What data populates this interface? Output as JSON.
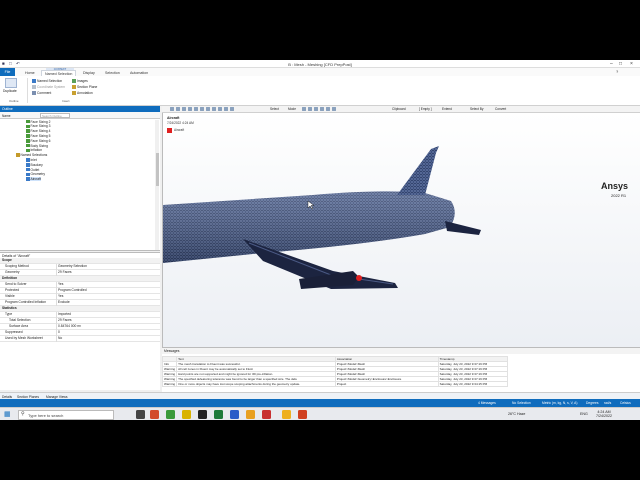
{
  "window": {
    "title": "B : Mesh - Meshing [CFD PrepPost]",
    "context_tab": "CONTEXT"
  },
  "ribbon_tabs": [
    "File",
    "Home",
    "Named Selection",
    "Display",
    "Selection",
    "Automation"
  ],
  "search_placeholder": "Quick Launch",
  "ribbon": {
    "duplicate": "Duplicate",
    "outline_group": "Outline",
    "named_selection": "Named Selection",
    "coordinate_system": "Coordinate System",
    "comment": "Comment",
    "images": "Images",
    "section_plane": "Section Plane",
    "annotation": "Annotation",
    "insert_group": "Insert"
  },
  "outline": {
    "title": "Outline",
    "name_col": "Name",
    "search_placeholder": "Search Outline",
    "items": [
      {
        "label": "Face Sizing 2",
        "indent": 1,
        "icon": "#4a9a3a"
      },
      {
        "label": "Face Sizing 3",
        "indent": 1,
        "icon": "#4a9a3a"
      },
      {
        "label": "Face Sizing 4",
        "indent": 1,
        "icon": "#4a9a3a"
      },
      {
        "label": "Face Sizing 5",
        "indent": 1,
        "icon": "#4a9a3a"
      },
      {
        "label": "Face Sizing 6",
        "indent": 1,
        "icon": "#4a9a3a"
      },
      {
        "label": "Body Sizing",
        "indent": 1,
        "icon": "#4a9a3a"
      },
      {
        "label": "Inflation",
        "indent": 1,
        "icon": "#4a9a3a"
      },
      {
        "label": "Named Selections",
        "indent": 0,
        "icon": "#c49a2a"
      },
      {
        "label": "Inlet",
        "indent": 1,
        "icon": "#3a7ac8"
      },
      {
        "label": "Boudary",
        "indent": 1,
        "icon": "#3a7ac8"
      },
      {
        "label": "Outlet",
        "indent": 1,
        "icon": "#3a7ac8"
      },
      {
        "label": "Geometry",
        "indent": 1,
        "icon": "#3a7ac8"
      },
      {
        "label": "Aircraft",
        "indent": 1,
        "icon": "#3a7ac8",
        "selected": true
      }
    ]
  },
  "details": {
    "title": "Details of \"Aircraft\"",
    "rows": [
      {
        "k": "Scope",
        "v": "",
        "sec": true
      },
      {
        "k": "Scoping Method",
        "v": "Geometry Selection"
      },
      {
        "k": "Geometry",
        "v": "29 Faces"
      },
      {
        "k": "Definition",
        "v": "",
        "sec": true
      },
      {
        "k": "Send to Solver",
        "v": "Yes"
      },
      {
        "k": "Protected",
        "v": "Program Controlled"
      },
      {
        "k": "Visible",
        "v": "Yes"
      },
      {
        "k": "Program Controlled Inflation",
        "v": "Exclude"
      },
      {
        "k": "Statistics",
        "v": "",
        "sec": true
      },
      {
        "k": "Type",
        "v": "Imported"
      },
      {
        "k": "Total Selection",
        "v": "29 Faces",
        "ind": true
      },
      {
        "k": "Surface Area",
        "v": "0.84764 000 m²",
        "ind": true
      },
      {
        "k": "Suppressed",
        "v": "0"
      },
      {
        "k": "Used by Mesh Worksheet",
        "v": "No"
      }
    ]
  },
  "toolbar": {
    "select": "Select",
    "mode": "Mode",
    "clipboard": "Clipboard",
    "empty": "[ Empty ]",
    "extend": "Extend",
    "select_by": "Select By",
    "convert": "Convert"
  },
  "viewport": {
    "title": "Aircraft",
    "date": "7/24/2022 4:24 AM",
    "legend": "Aircraft",
    "brand": "Ansys",
    "version": "2022 R1",
    "scale_labels": [
      "0.000",
      "0.150",
      "0.300 (m)"
    ],
    "scale_labels_sub": [
      "0.075",
      "0.225"
    ]
  },
  "messages": {
    "title": "Messages",
    "columns": [
      "",
      "Text",
      "Association",
      "Timestamp"
    ],
    "rows": [
      [
        "Info",
        "The mesh translation to Fluent was successful.",
        "Project>Model>Mesh",
        "Saturday, July 23, 2022 9:37:19 PM"
      ],
      [
        "Warning",
        "All cell zones in Fluent may be automatically set to Fluid.",
        "Project>Model>Mesh",
        "Saturday, July 23, 2022 9:37:19 PM"
      ],
      [
        "Warning",
        "Hard points are not supported and might be ignored for 3D pre-inflation.",
        "Project>Model>Mesh",
        "Saturday, July 23, 2022 9:37:19 PM"
      ],
      [
        "Warning",
        "The specified defeaturing tolerance was found to be larger than a specified size. The defe",
        "Project>Model>Geometry>Enclosure>Enclosure",
        "Saturday, July 23, 2022 9:37:19 PM"
      ],
      [
        "Warning",
        "One or more objects may have lost scope scoping attachments during the geometry update.",
        "Project",
        "Saturday, July 23, 2022 9:34:15 PM"
      ]
    ]
  },
  "bottom_tabs": [
    "Details",
    "Section Planes",
    "Manage Views"
  ],
  "status": {
    "messages": "4 Messages",
    "selection": "No Selection",
    "units": "Metric (m, kg, N, s, V, A)",
    "degrees": "Degrees",
    "rad": "rad/s",
    "temp": "Celsius"
  },
  "taskbar": {
    "search": "Type here to search",
    "weather": "26°C Haze",
    "lang": "ENG",
    "time": "4:24 AM",
    "date": "7/24/2022"
  },
  "colors": {
    "accent": "#0f6cbd",
    "mesh": "#2e3f6a",
    "selection_red": "#e02020"
  }
}
